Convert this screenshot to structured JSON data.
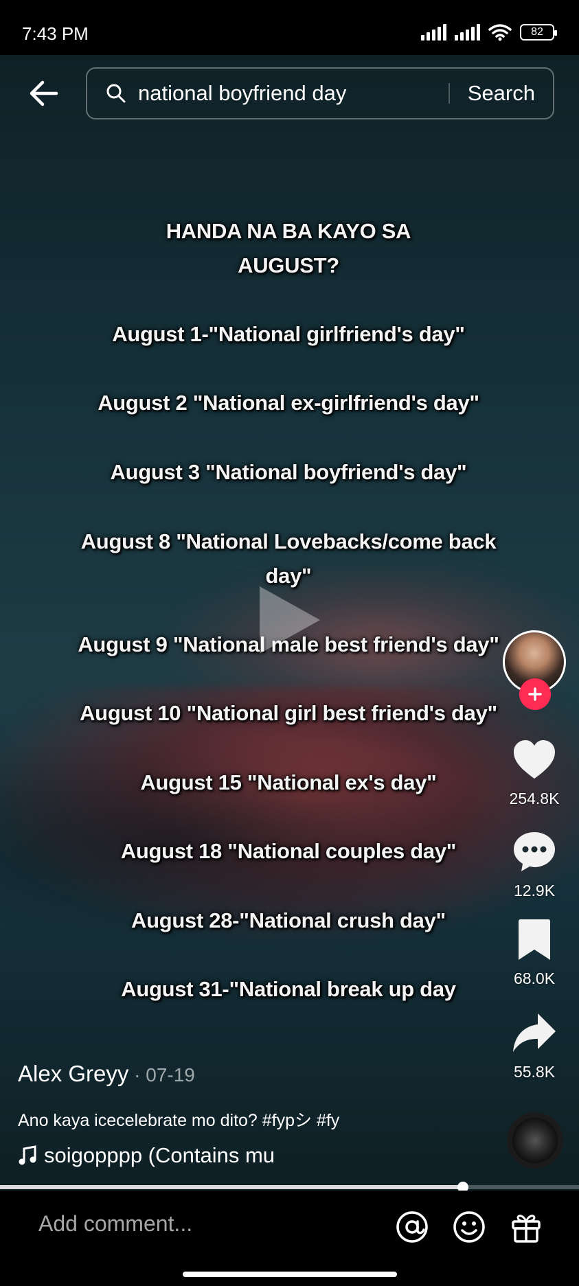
{
  "status_bar": {
    "time": "7:43 PM",
    "battery": "82"
  },
  "search": {
    "query": "national boyfriend day",
    "button_label": "Search"
  },
  "overlay": {
    "heading": [
      "HANDA NA BA KAYO SA",
      "AUGUST?"
    ],
    "lines": [
      [
        "August 1-\"National girlfriend's day\""
      ],
      [
        "August 2 \"National ex-girlfriend's day\""
      ],
      [
        "August 3 \"National boyfriend's day\""
      ],
      [
        "August 8 \"National Lovebacks/come back",
        "day\""
      ],
      [
        "August 9 \"National male best friend's day\""
      ],
      [
        "August 10 \"National girl best friend's day\""
      ],
      [
        "August 15 \"National ex's day\""
      ],
      [
        "August 18 \"National couples day\""
      ],
      [
        "August 28-\"National crush day\""
      ],
      [
        "August 31-\"National break up day"
      ]
    ]
  },
  "actions": {
    "likes": "254.8K",
    "comments": "12.9K",
    "saves": "68.0K",
    "shares": "55.8K"
  },
  "post": {
    "author": "Alex Greyy",
    "date": " · 07-19",
    "caption": "Ano kaya icecelebrate mo dito? #fypシ #fy",
    "music": "soigopppp (Contains mu"
  },
  "progress": {
    "fraction": 0.8
  },
  "comment_bar": {
    "placeholder": "Add comment..."
  },
  "colors": {
    "accent": "#fe2c55"
  }
}
